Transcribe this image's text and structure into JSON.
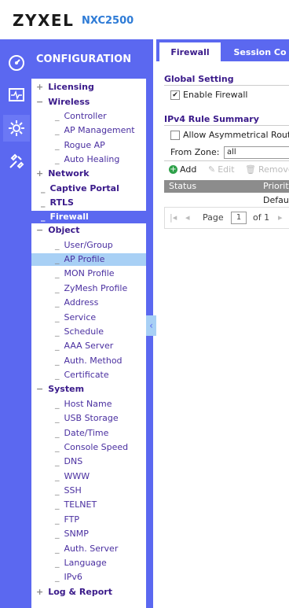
{
  "header": {
    "brand": "ZYXEL",
    "model": "NXC2500"
  },
  "nav": {
    "title": "CONFIGURATION",
    "items": [
      {
        "label": "Licensing",
        "marker": "+"
      },
      {
        "label": "Wireless",
        "marker": "−"
      },
      {
        "label": "Controller",
        "marker": "_"
      },
      {
        "label": "AP Management",
        "marker": "_"
      },
      {
        "label": "Rogue AP",
        "marker": "_"
      },
      {
        "label": "Auto Healing",
        "marker": "_"
      },
      {
        "label": "Network",
        "marker": "+"
      },
      {
        "label": "Captive Portal",
        "marker": "_"
      },
      {
        "label": "RTLS",
        "marker": "_"
      },
      {
        "label": "Firewall",
        "marker": "_"
      },
      {
        "label": "Object",
        "marker": "−"
      },
      {
        "label": "User/Group",
        "marker": "_"
      },
      {
        "label": "AP Profile",
        "marker": "_"
      },
      {
        "label": "MON Profile",
        "marker": "_"
      },
      {
        "label": "ZyMesh Profile",
        "marker": "_"
      },
      {
        "label": "Address",
        "marker": "_"
      },
      {
        "label": "Service",
        "marker": "_"
      },
      {
        "label": "Schedule",
        "marker": "_"
      },
      {
        "label": "AAA Server",
        "marker": "_"
      },
      {
        "label": "Auth. Method",
        "marker": "_"
      },
      {
        "label": "Certificate",
        "marker": "_"
      },
      {
        "label": "System",
        "marker": "−"
      },
      {
        "label": "Host Name",
        "marker": "_"
      },
      {
        "label": "USB Storage",
        "marker": "_"
      },
      {
        "label": "Date/Time",
        "marker": "_"
      },
      {
        "label": "Console Speed",
        "marker": "_"
      },
      {
        "label": "DNS",
        "marker": "_"
      },
      {
        "label": "WWW",
        "marker": "_"
      },
      {
        "label": "SSH",
        "marker": "_"
      },
      {
        "label": "TELNET",
        "marker": "_"
      },
      {
        "label": "FTP",
        "marker": "_"
      },
      {
        "label": "SNMP",
        "marker": "_"
      },
      {
        "label": "Auth. Server",
        "marker": "_"
      },
      {
        "label": "Language",
        "marker": "_"
      },
      {
        "label": "IPv6",
        "marker": "_"
      },
      {
        "label": "Log & Report",
        "marker": "+"
      }
    ]
  },
  "tabs": {
    "firewall": "Firewall",
    "session": "Session Co"
  },
  "global_setting": {
    "title": "Global Setting",
    "enable_firewall": "Enable Firewall",
    "enable_checked": "✔"
  },
  "ipv4": {
    "title": "IPv4 Rule Summary",
    "allow_asym": "Allow Asymmetrical Route",
    "from_zone_label": "From Zone:",
    "from_zone_value": "all"
  },
  "toolbar": {
    "add": "Add",
    "edit": "Edit",
    "remove": "Remove"
  },
  "table": {
    "col_status": "Status",
    "col_priority": "Priority",
    "row1_priority": "Default"
  },
  "pager": {
    "page_label": "Page",
    "page_value": "1",
    "of_label": "of 1"
  },
  "colors": {
    "accent": "#5b68f0",
    "selection": "#a8d0f5",
    "nav_text": "#3a1a8a",
    "model": "#2e7bd6"
  }
}
